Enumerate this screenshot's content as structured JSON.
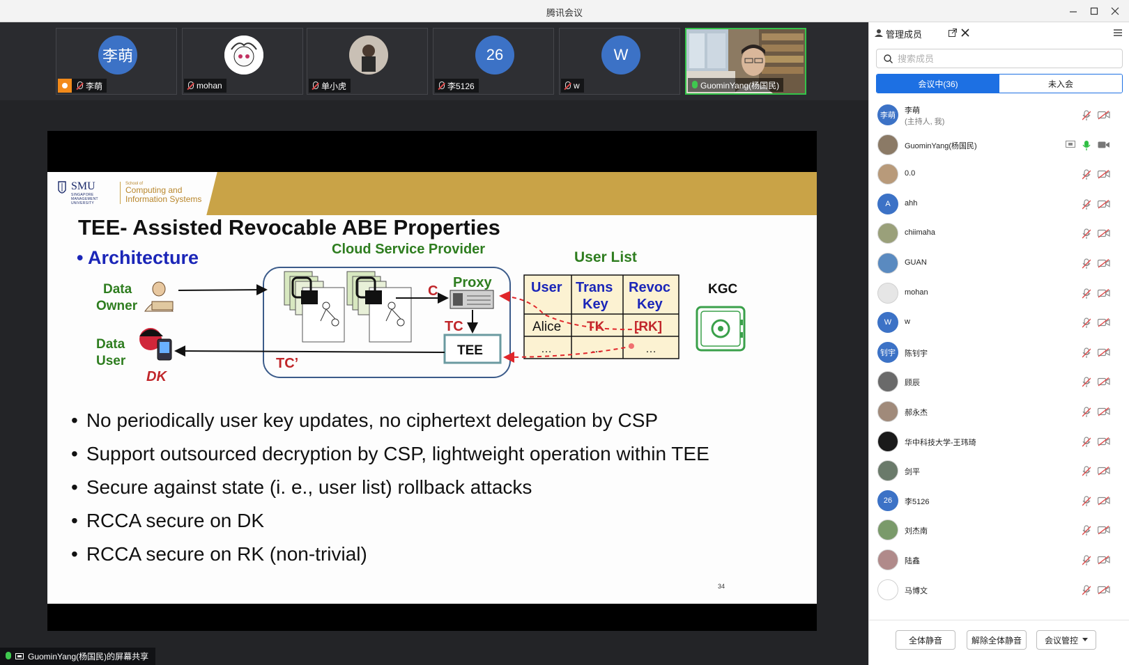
{
  "window": {
    "title": "腾讯会议"
  },
  "video_strip": {
    "tiles": [
      {
        "name": "李萌",
        "avatar_text": "李萌",
        "avatar_color": "#3c72c6",
        "host": true
      },
      {
        "name": "mohan",
        "avatar_text": "",
        "avatar_color": "#f2f2f2"
      },
      {
        "name": "单小虎",
        "avatar_text": "",
        "avatar_color": "#7a6a5a"
      },
      {
        "name": "李5126",
        "avatar_text": "26",
        "avatar_color": "#3c72c6"
      },
      {
        "name": "w",
        "avatar_text": "W",
        "avatar_color": "#3c72c6"
      },
      {
        "name": "GuominYang(杨国民)",
        "avatar_text": "",
        "avatar_color": "#8b7a66",
        "speaking": true
      }
    ]
  },
  "slide": {
    "smu": "SMU",
    "smu_sub": "SINGAPORE MANAGEMENT UNIVERSITY",
    "school_line1": "School of",
    "school_line2": "Computing and",
    "school_line3": "Information Systems",
    "title": "TEE- Assisted Revocable ABE Properties",
    "architecture": "• Architecture",
    "diagram": {
      "csp": "Cloud Service Provider",
      "user_list": "User List",
      "proxy": "Proxy",
      "c": "C",
      "tc": "TC",
      "tee": "TEE",
      "tc_prime": "TC’",
      "data_owner_1": "Data",
      "data_owner_2": "Owner",
      "data_user_1": "Data",
      "data_user_2": "User",
      "dk": "DK",
      "kgc": "KGC",
      "table_headers": [
        [
          "User"
        ],
        [
          "Trans",
          "Key"
        ],
        [
          "Revoc",
          "Key"
        ]
      ],
      "table_rows": [
        [
          "Alice",
          "TK",
          "[RK]"
        ],
        [
          "…",
          "…",
          "…"
        ]
      ]
    },
    "bullets": [
      "No periodically user key updates, no ciphertext delegation by CSP",
      "Support outsourced decryption by CSP, lightweight operation within TEE",
      "Secure against state (i. e., user list) rollback attacks",
      "RCCA secure on DK",
      "RCCA secure on RK (non-trivial)"
    ],
    "page_number": "34"
  },
  "share_status": "GuominYang(杨国民)的屏幕共享",
  "panel": {
    "title": "管理成员",
    "search_placeholder": "搜索成员",
    "tab_in_meeting": "会议中(36)",
    "tab_not_joined": "未入会",
    "members": [
      {
        "name": "李萌",
        "sub": "(主持人, 我)",
        "avatar_text": "李萌",
        "avatar_color": "#3c72c6"
      },
      {
        "name": "GuominYang(杨国民)",
        "avatar_text": "",
        "avatar_color": "#8b7a66",
        "speaking": true,
        "sharing": true
      },
      {
        "name": "0.0",
        "avatar_text": "",
        "avatar_color": "#b89a7a"
      },
      {
        "name": "ahh",
        "avatar_text": "A",
        "avatar_color": "#3c72c6"
      },
      {
        "name": "chiimaha",
        "avatar_text": "",
        "avatar_color": "#9aa07a"
      },
      {
        "name": "GUAN",
        "avatar_text": "",
        "avatar_color": "#5a8ac0"
      },
      {
        "name": "mohan",
        "avatar_text": "",
        "avatar_color": "#e6e6e6"
      },
      {
        "name": "w",
        "avatar_text": "W",
        "avatar_color": "#3c72c6"
      },
      {
        "name": "陈钊宇",
        "avatar_text": "钊宇",
        "avatar_color": "#3c72c6"
      },
      {
        "name": "顾辰",
        "avatar_text": "",
        "avatar_color": "#6a6a6a"
      },
      {
        "name": "郝永杰",
        "avatar_text": "",
        "avatar_color": "#a08a7a"
      },
      {
        "name": "华中科技大学-王玮琦",
        "avatar_text": "",
        "avatar_color": "#1a1a1a"
      },
      {
        "name": "剑平",
        "avatar_text": "",
        "avatar_color": "#6a7a6a"
      },
      {
        "name": "李5126",
        "avatar_text": "26",
        "avatar_color": "#3c72c6"
      },
      {
        "name": "刘杰南",
        "avatar_text": "",
        "avatar_color": "#7a9a6a"
      },
      {
        "name": "陆鑫",
        "avatar_text": "",
        "avatar_color": "#b08a8a"
      },
      {
        "name": "马博文",
        "avatar_text": "",
        "avatar_color": "#ffffff"
      }
    ],
    "mute_all": "全体静音",
    "unmute_all": "解除全体静音",
    "meeting_control": "会议管控"
  }
}
